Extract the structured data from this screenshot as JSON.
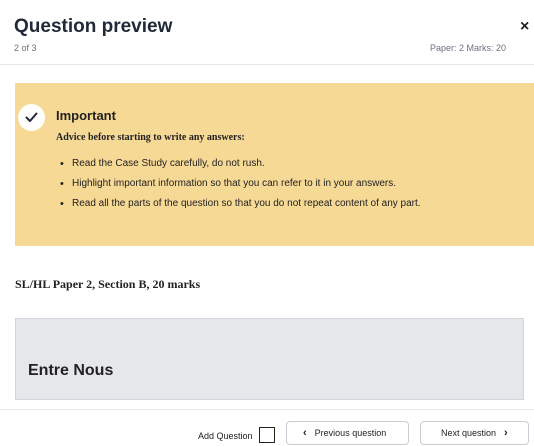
{
  "header": {
    "title": "Question preview",
    "counter": "2 of 3",
    "meta": "Paper: 2 Marks: 20",
    "close_label": "×"
  },
  "important": {
    "title": "Important",
    "advice": "Advice before starting to write any answers:",
    "bullets": [
      "Read the Case Study carefully, do not rush.",
      "Highlight important information so that you can refer to it in your answers.",
      "Read all the parts of the question so that you do not repeat content of any part."
    ],
    "icon": "check-icon",
    "background_color": "#f7d996"
  },
  "section": {
    "label": "SL/HL Paper 2, Section B, 20 marks"
  },
  "case_study": {
    "title": "Entre Nous"
  },
  "footer": {
    "add_question_label": "Add Question",
    "add_question_checked": false,
    "previous_label": "Previous question",
    "next_label": "Next question",
    "prev_icon": "chevron-left-icon",
    "next_icon": "chevron-right-icon"
  }
}
